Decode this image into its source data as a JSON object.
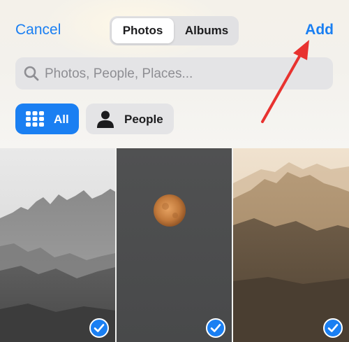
{
  "topbar": {
    "cancel_label": "Cancel",
    "add_label": "Add",
    "tabs": [
      {
        "label": "Photos",
        "selected": true
      },
      {
        "label": "Albums",
        "selected": false
      }
    ]
  },
  "search": {
    "placeholder": "Photos, People, Places...",
    "value": ""
  },
  "filters": [
    {
      "label": "All",
      "icon": "grid-icon",
      "selected": true
    },
    {
      "label": "People",
      "icon": "person-icon",
      "selected": false
    }
  ],
  "photos": [
    {
      "subject": "grayscale mountains",
      "selected": true
    },
    {
      "subject": "orange moon",
      "selected": true
    },
    {
      "subject": "sepia mountains",
      "selected": true
    }
  ],
  "colors": {
    "accent": "#1a7ff2",
    "annotation_arrow": "#e8322f"
  }
}
